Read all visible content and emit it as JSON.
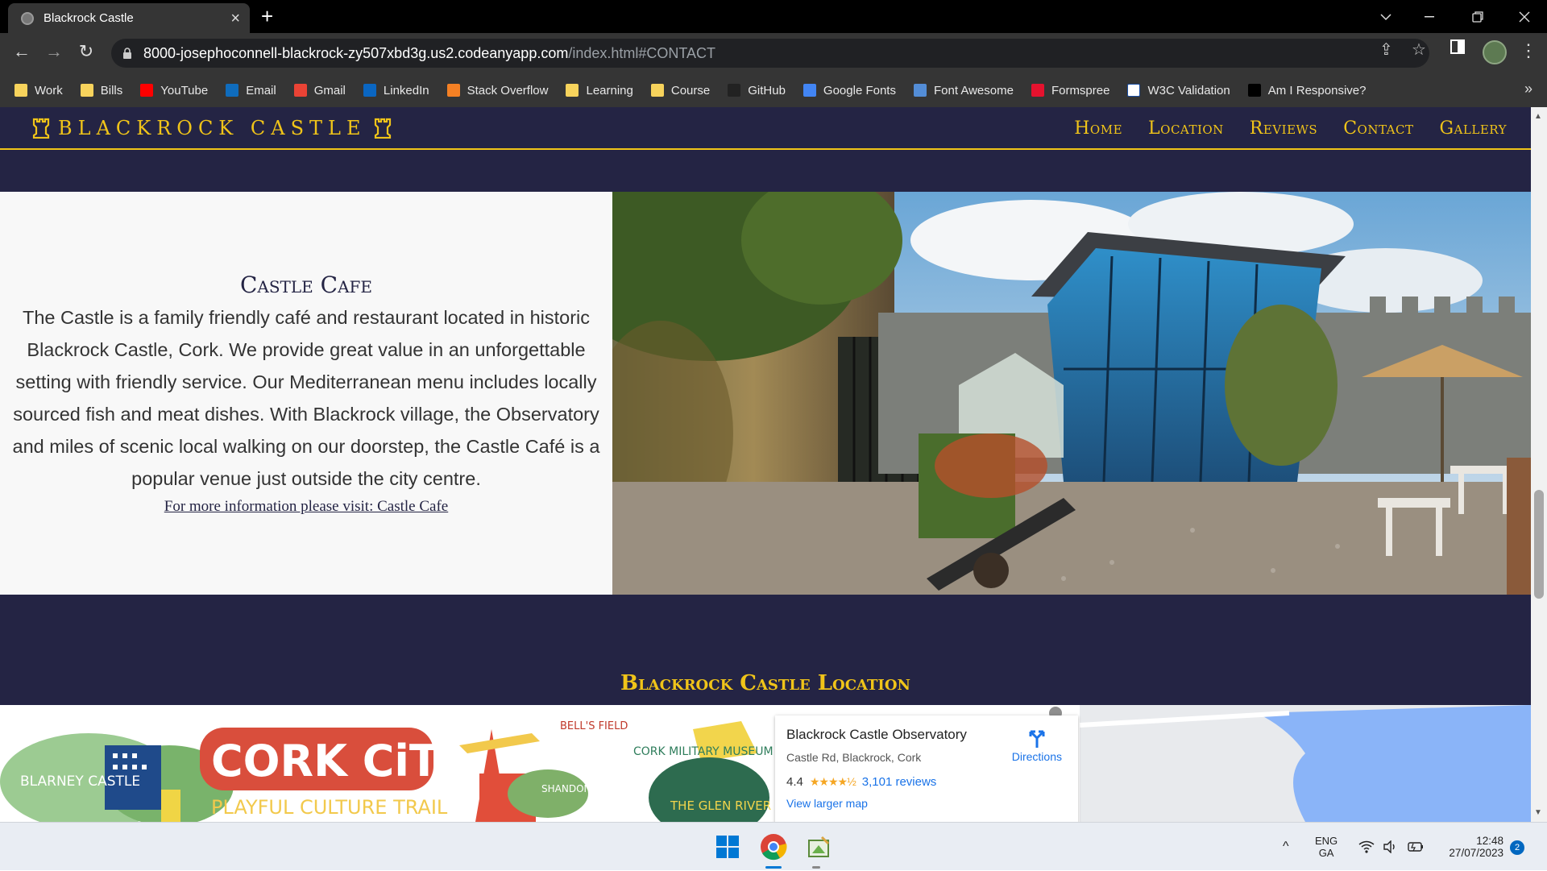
{
  "browser": {
    "tab_title": "Blackrock Castle",
    "url_main": "8000-josephoconnell-blackrock-zy507xbd3g.us2.codeanyapp.com",
    "url_path": "/index.html#CONTACT",
    "bookmarks": [
      {
        "label": "Work",
        "icon": "folder-icon",
        "color": "#f7d35c"
      },
      {
        "label": "Bills",
        "icon": "folder-icon",
        "color": "#f7d35c"
      },
      {
        "label": "YouTube",
        "icon": "youtube-icon",
        "color": "#ff0000"
      },
      {
        "label": "Email",
        "icon": "outlook-icon",
        "color": "#0f6cbd"
      },
      {
        "label": "Gmail",
        "icon": "gmail-icon",
        "color": "#ea4335"
      },
      {
        "label": "LinkedIn",
        "icon": "linkedin-icon",
        "color": "#0a66c2"
      },
      {
        "label": "Stack Overflow",
        "icon": "stackoverflow-icon",
        "color": "#f48024"
      },
      {
        "label": "Learning",
        "icon": "folder-icon",
        "color": "#f7d35c"
      },
      {
        "label": "Course",
        "icon": "folder-icon",
        "color": "#f7d35c"
      },
      {
        "label": "GitHub",
        "icon": "github-icon",
        "color": "#222222"
      },
      {
        "label": "Google Fonts",
        "icon": "google-fonts-icon",
        "color": "#4285f4"
      },
      {
        "label": "Font Awesome",
        "icon": "flag-icon",
        "color": "#538dd7"
      },
      {
        "label": "Formspree",
        "icon": "formspree-icon",
        "color": "#e5122e"
      },
      {
        "label": "W3C Validation",
        "icon": "w3c-icon",
        "color": "#ffffff"
      },
      {
        "label": "Am I Responsive?",
        "icon": "amiresponsive-icon",
        "color": "#000000"
      }
    ]
  },
  "site": {
    "brand": "BLACKROCK CASTLE",
    "nav": [
      "Home",
      "Location",
      "Reviews",
      "Contact",
      "Gallery"
    ],
    "accent_color": "#f0c419",
    "bg_color": "#242444"
  },
  "cafe": {
    "title": "Castle Cafe",
    "body": "The Castle is a family friendly café and restaurant located in historic Blackrock Castle, Cork. We provide great value in an unforgettable setting with friendly service. Our Mediterranean menu includes locally sourced fish and meat dishes. With Blackrock village, the Observatory and miles of scenic local walking on our doorstep, the Castle Café is a popular venue just outside the city centre.",
    "link": "For more information please visit: Castle Cafe"
  },
  "location": {
    "title": "Blackrock Castle Location",
    "map_art": {
      "blarney": "BLARNEY CASTLE",
      "cork_city": "CORK CiTY",
      "trail": "PLAYFUL CULTURE TRAIL",
      "bells": "BELL'S FIELD",
      "museum": "CORK MILITARY MUSEUM",
      "shandon": "SHANDON BELLS AND TOWER",
      "glen": "THE GLEN RIVER PARK"
    },
    "place": {
      "name": "Blackrock Castle Observatory",
      "address": "Castle Rd, Blackrock, Cork",
      "rating": "4.4",
      "stars": "★★★★½",
      "reviews": "3,101 reviews",
      "larger_map": "View larger map",
      "directions": "Directions"
    }
  },
  "taskbar": {
    "lang_top": "ENG",
    "lang_bottom": "GA",
    "time": "12:48",
    "date": "27/07/2023",
    "notifications": "2"
  }
}
